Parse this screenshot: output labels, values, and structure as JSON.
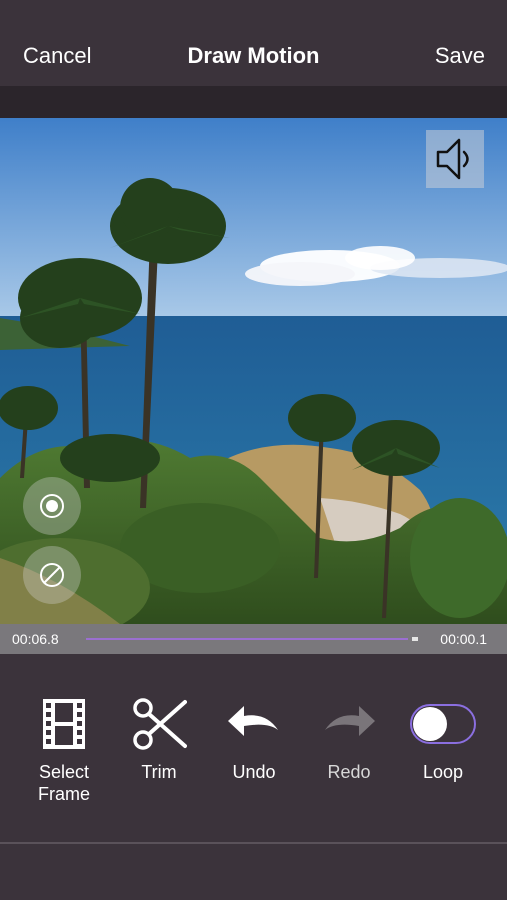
{
  "nav": {
    "cancel_label": "Cancel",
    "title": "Draw Motion",
    "save_label": "Save"
  },
  "video": {
    "sound_icon": "speaker-icon",
    "controls": [
      {
        "icon": "target-icon"
      },
      {
        "icon": "no-symbol-icon"
      }
    ]
  },
  "timeline": {
    "current_time": "00:06.8",
    "remaining_time": "00:00.1",
    "accent_color": "#9b6fd1"
  },
  "toolbar": {
    "items": [
      {
        "label_line1": "Select",
        "label_line2": "Frame",
        "icon": "film-strip-icon"
      },
      {
        "label": "Trim",
        "icon": "scissors-icon"
      },
      {
        "label": "Undo",
        "icon": "undo-arrow-icon"
      },
      {
        "label": "Redo",
        "icon": "redo-arrow-icon",
        "disabled": true
      },
      {
        "label": "Loop",
        "icon": "toggle-switch",
        "on": false
      }
    ]
  },
  "colors": {
    "background": "#3b333b",
    "toggle_border": "#8b6fe0"
  }
}
